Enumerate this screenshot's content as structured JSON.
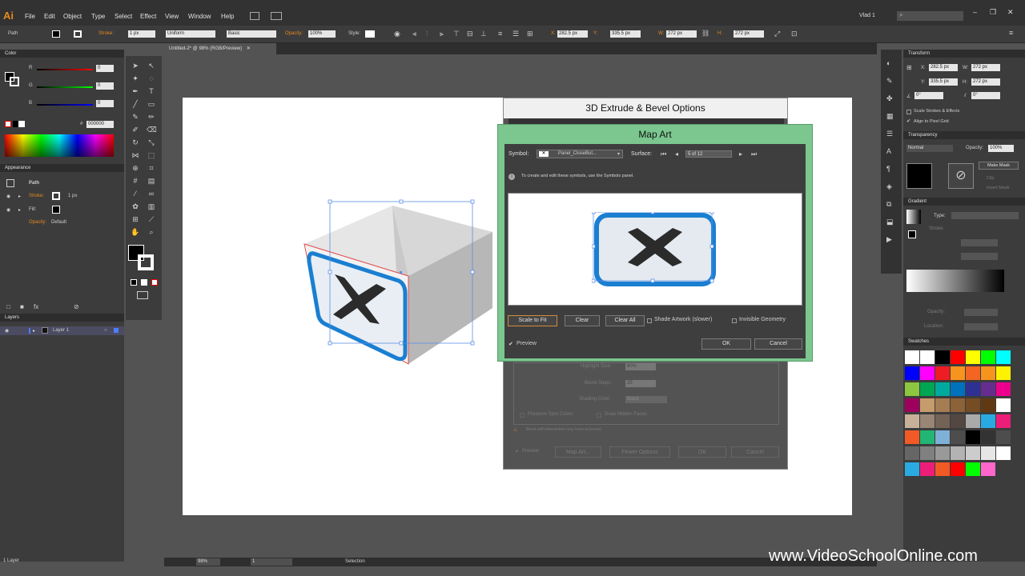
{
  "app": {
    "logo": "Ai"
  },
  "menu": [
    "File",
    "Edit",
    "Object",
    "Type",
    "Select",
    "Effect",
    "View",
    "Window",
    "Help"
  ],
  "menubar_right": {
    "user": "Vlad 1"
  },
  "control_bar": {
    "object_type": "Path",
    "stroke_label": "Stroke:",
    "stroke_value": "1 px",
    "profile": "Uniform",
    "brush": "Basic",
    "opacity_label": "Opacity:",
    "opacity_value": "100%",
    "style_label": "Style:",
    "x_label": "X:",
    "x_value": "282.5 px",
    "y_label": "Y:",
    "y_value": "335.5 px",
    "w_label": "W:",
    "w_value": "272 px",
    "h_label": "H:",
    "h_value": "272 px"
  },
  "document_tab": "Untitled-2* @ 98% (RGB/Preview)",
  "color_panel": {
    "title": "Color",
    "r_label": "R",
    "g_label": "G",
    "b_label": "B",
    "r": "0",
    "g": "0",
    "b": "0",
    "hex": "000000",
    "hash": "#"
  },
  "appearance_panel": {
    "title": "Appearance",
    "header": "Path",
    "stroke_label": "Stroke:",
    "stroke_value": "1 px",
    "fill_label": "Fill:",
    "opacity_label": "Opacity:",
    "opacity_value": "Default"
  },
  "layers_panel": {
    "title": "Layers",
    "layer_name": "Layer 1",
    "count": "1 Layer"
  },
  "transform_panel": {
    "title": "Transform",
    "x_label": "X:",
    "x": "282.5 px",
    "y_label": "Y:",
    "y": "335.5 px",
    "w_label": "W:",
    "w": "272 px",
    "h_label": "H:",
    "h": "272 px",
    "angle": "0°",
    "shear": "0°",
    "scale_strokes": "Scale Strokes & Effects",
    "align_pixel": "Align to Pixel Grid"
  },
  "transparency_panel": {
    "title": "Transparency",
    "mode": "Normal",
    "opacity_label": "Opacity:",
    "opacity": "100%",
    "make_mask": "Make Mask",
    "clip": "Clip",
    "invert_mask": "Invert Mask"
  },
  "gradient_panel": {
    "title": "Gradient",
    "type_label": "Type:",
    "stroke_label": "Stroke:",
    "opacity_label": "Opacity:",
    "location_label": "Location:"
  },
  "swatches_panel": {
    "title": "Swatches"
  },
  "swatch_colors": [
    "#ffffff",
    "#ffffff",
    "#000000",
    "#ff0000",
    "#ffff00",
    "#00ff00",
    "#00ffff",
    "#0000ff",
    "#ff00ff",
    "#ee1c24",
    "#f7941d",
    "#f26522",
    "#f7941d",
    "#fff200",
    "#8dc63f",
    "#00a651",
    "#00a99d",
    "#0072bc",
    "#2e3192",
    "#662d91",
    "#ec008c",
    "#9e005d",
    "#c69c6d",
    "#a67c52",
    "#8c6239",
    "#754c24",
    "#603913",
    "#ffffff",
    "#c7b299",
    "#998675",
    "#736357",
    "#534741",
    "#aaaaaa",
    "#29abe2",
    "#ed1e79",
    "#f15a24",
    "#22b573",
    "#7fb0d6",
    "#4d4d4d",
    "#000000",
    "#333333",
    "#4d4d4d",
    "#666666",
    "#808080",
    "#999999",
    "#b3b3b3",
    "#cccccc",
    "#e6e6e6",
    "#ffffff",
    "#29abe2",
    "#ed1e79",
    "#f15a24",
    "#ff0000",
    "#00ff00",
    "#ff66cc"
  ],
  "dialog_3d": {
    "title": "3D Extrude & Bevel Options",
    "highlight_size_label": "Highlight Size:",
    "highlight_size": "90%",
    "blend_steps_label": "Blend Steps:",
    "blend_steps": "25",
    "shading_color_label": "Shading Color:",
    "shading_color": "Black",
    "preserve_spot": "Preserve Spot Colors",
    "draw_hidden": "Draw Hidden Faces",
    "warning": "Bevel self-intersection may have occurred.",
    "preview": "Preview",
    "map_art": "Map Art...",
    "fewer_options": "Fewer Options",
    "ok": "OK",
    "cancel": "Cancel"
  },
  "map_art": {
    "title": "Map Art",
    "symbol_label": "Symbol:",
    "symbol_value": "Panel_CloseBut...",
    "surface_label": "Surface:",
    "surface_value": "5 of 12",
    "info": "To create and edit these symbols, use the Symbols panel.",
    "scale_to_fit": "Scale to Fit",
    "clear": "Clear",
    "clear_all": "Clear All",
    "shade_artwork": "Shade Artwork (slower)",
    "invisible_geometry": "Invisible Geometry",
    "preview": "Preview",
    "ok": "OK",
    "cancel": "Cancel"
  },
  "status_bar": {
    "zoom": "98%",
    "page": "1",
    "tool": "Selection"
  },
  "watermark": "www.VideoSchoolOnline.com"
}
